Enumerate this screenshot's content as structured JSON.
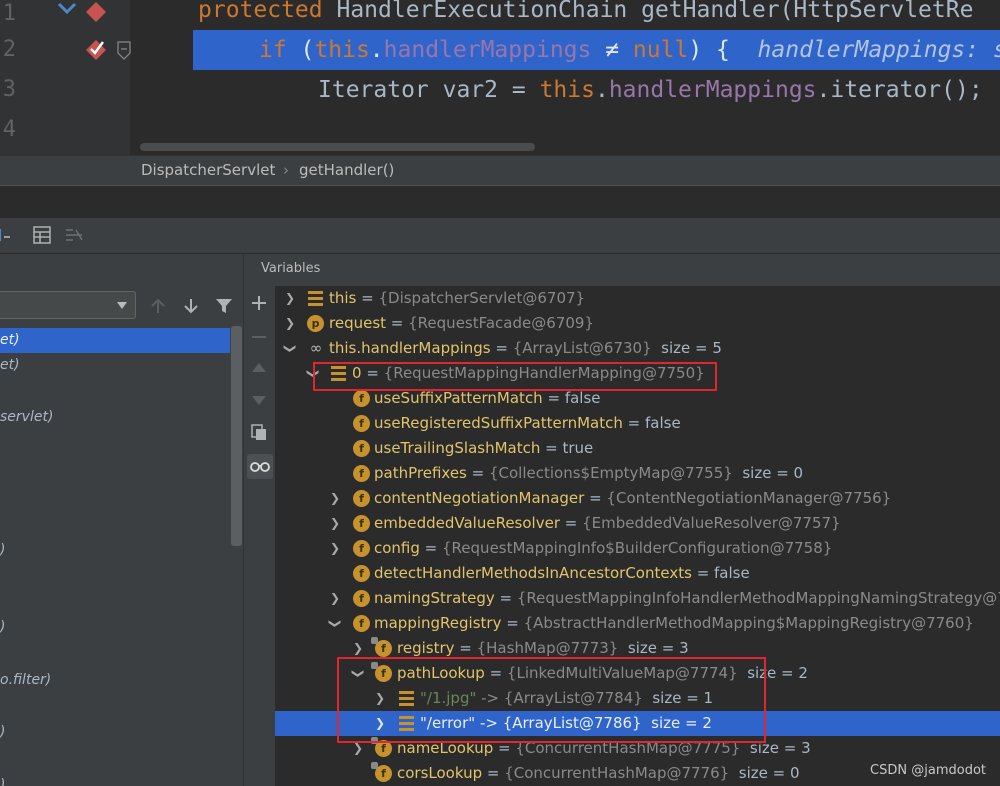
{
  "editor": {
    "line_numbers": [
      "1",
      "2",
      "3",
      "4"
    ],
    "line1": {
      "kw": "protected",
      "rest": " HandlerExecutionChain getHandler(HttpServletRe"
    },
    "line2": {
      "kw_if": "if",
      "paren": " (",
      "this": "this",
      "dot": ".",
      "field": "handlerMappings",
      "ne": " ≠ ",
      "kw_null": "null",
      "close": ") {",
      "comment": "  handlerMappings: s"
    },
    "line3": {
      "type": "Iterator var2 = ",
      "this": "this",
      "dot": ".",
      "field": "handlerMappings",
      "rest": ".iterator();"
    }
  },
  "breadcrumbs": {
    "class_name": "DispatcherServlet",
    "separator": "›",
    "method_name": "getHandler()"
  },
  "frames": {
    "rows": [
      "et)",
      "et)",
      "servlet)",
      ")",
      ")",
      "o.filter)",
      ")",
      ")"
    ]
  },
  "variables": {
    "header": "Variables",
    "rows": [
      {
        "name": "this",
        "value": "{DispatcherServlet@6707}",
        "size": ""
      },
      {
        "name": "request",
        "value": "{RequestFacade@6709}",
        "size": ""
      },
      {
        "name": "this.handlerMappings",
        "value": "{ArrayList@6730}",
        "size": "size = 5"
      },
      {
        "name": "0",
        "value": "{RequestMappingHandlerMapping@7750}",
        "size": ""
      },
      {
        "name": "useSuffixPatternMatch",
        "value": "false",
        "size": ""
      },
      {
        "name": "useRegisteredSuffixPatternMatch",
        "value": "false",
        "size": ""
      },
      {
        "name": "useTrailingSlashMatch",
        "value": "true",
        "size": ""
      },
      {
        "name": "pathPrefixes",
        "value": "{Collections$EmptyMap@7755}",
        "size": "size = 0"
      },
      {
        "name": "contentNegotiationManager",
        "value": "{ContentNegotiationManager@7756}",
        "size": ""
      },
      {
        "name": "embeddedValueResolver",
        "value": "{EmbeddedValueResolver@7757}",
        "size": ""
      },
      {
        "name": "config",
        "value": "{RequestMappingInfo$BuilderConfiguration@7758}",
        "size": ""
      },
      {
        "name": "detectHandlerMethodsInAncestorContexts",
        "value": "false",
        "size": ""
      },
      {
        "name": "namingStrategy",
        "value": "{RequestMappingInfoHandlerMethodMappingNamingStrategy@77",
        "size": ""
      },
      {
        "name": "mappingRegistry",
        "value": "{AbstractHandlerMethodMapping$MappingRegistry@7760}",
        "size": ""
      },
      {
        "name": "registry",
        "value": "{HashMap@7773}",
        "size": "size = 3"
      },
      {
        "name": "pathLookup",
        "value": "{LinkedMultiValueMap@7774}",
        "size": "size = 2"
      },
      {
        "name": "\"/1.jpg\"",
        "value": "{ArrayList@7784}",
        "size": "size = 1"
      },
      {
        "name": "\"/error\"",
        "value": "{ArrayList@7786}",
        "size": "size = 2"
      },
      {
        "name": "nameLookup",
        "value": "{ConcurrentHashMap@7775}",
        "size": "size = 3"
      },
      {
        "name": "corsLookup",
        "value": "{ConcurrentHashMap@7776}",
        "size": "size = 0"
      }
    ],
    "eq": " = ",
    "arrow": " -> "
  },
  "watermark": "CSDN @jamdodot",
  "colors": {
    "selection": "#2f65ca",
    "highlight_box": "#e0262e",
    "field_icon": "#c6922d"
  }
}
